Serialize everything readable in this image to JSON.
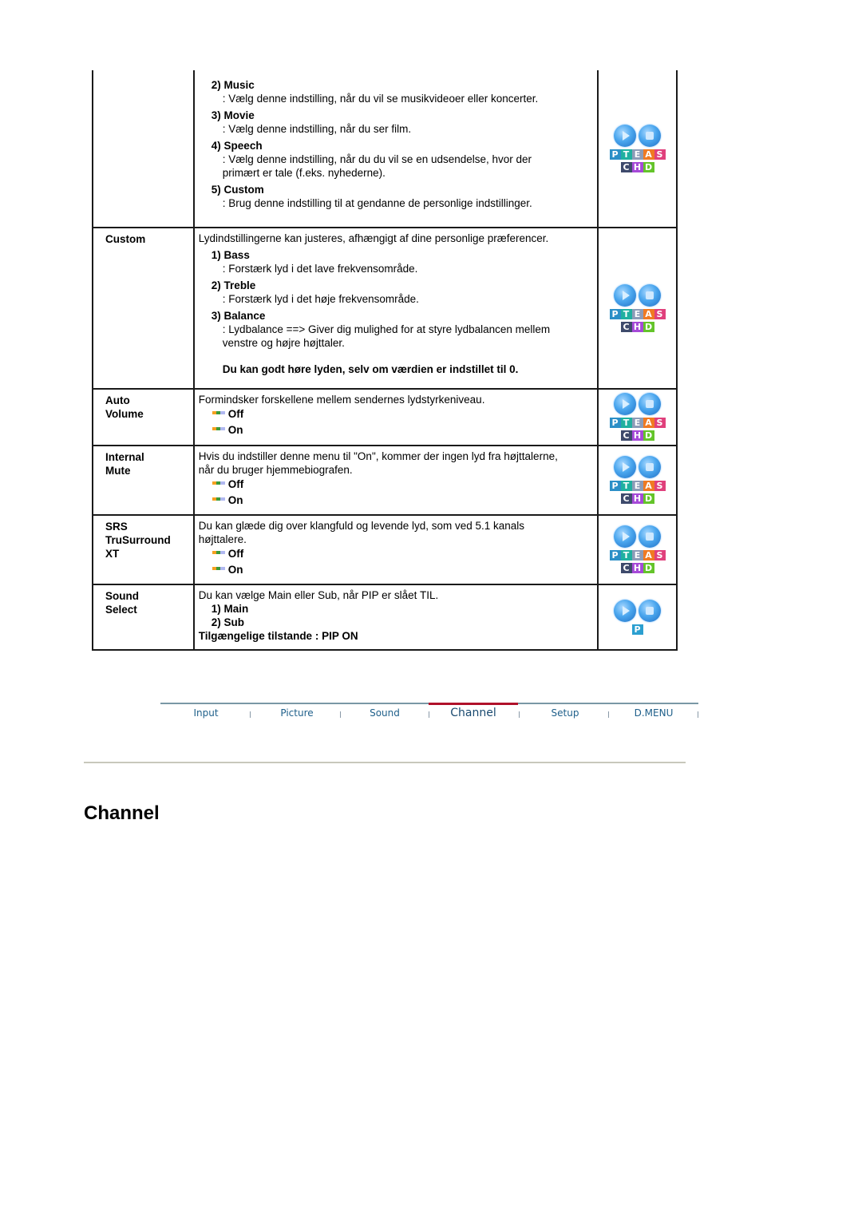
{
  "table": {
    "rows": [
      {
        "label_lines": [],
        "items": [
          {
            "title": "2) Music",
            "desc": [
              ": Vælg denne indstilling, når du vil se musikvideoer eller koncerter."
            ]
          },
          {
            "title": "3) Movie",
            "desc": [
              ": Vælg denne indstilling, når du ser film."
            ]
          },
          {
            "title": "4) Speech",
            "desc": [
              ": Vælg denne indstilling, når du du vil se en udsendelse, hvor der",
              "primært er tale (f.eks. nyhederne)."
            ]
          },
          {
            "title": "5) Custom",
            "desc": [
              ": Brug denne indstilling til at gendanne de personlige indstillinger."
            ]
          }
        ],
        "icon": "ptea-schd-mode-icon"
      },
      {
        "label_lines": [
          "Custom"
        ],
        "intro": "Lydindstillingerne kan justeres, afhængigt af dine personlige præferencer.",
        "items": [
          {
            "title": "1) Bass",
            "desc": [
              ": Forstærk lyd i det lave frekvensområde."
            ]
          },
          {
            "title": "2) Treble",
            "desc": [
              ": Forstærk lyd i det høje frekvensområde."
            ]
          },
          {
            "title": "3) Balance",
            "desc": [
              ": Lydbalance ==> Giver dig mulighed for at styre lydbalancen mellem",
              "venstre og højre højttaler."
            ]
          }
        ],
        "note": "Du kan godt høre lyden, selv om værdien er indstillet til 0.",
        "icon": "ptea-schd-mode-icon"
      },
      {
        "label_lines": [
          "Auto",
          "Volume"
        ],
        "intro": "Formindsker forskellene mellem sendernes lydstyrkeniveau.",
        "options": [
          "Off",
          "On"
        ],
        "icon": "ptea-schd-mode-icon"
      },
      {
        "label_lines": [
          "Internal",
          "Mute"
        ],
        "intro_lines": [
          "Hvis du indstiller denne menu til \"On\", kommer der ingen lyd fra højttalerne,",
          "når du bruger hjemmebiografen."
        ],
        "options": [
          "Off",
          "On"
        ],
        "icon": "ptea-schd-mode-icon"
      },
      {
        "label_lines": [
          "SRS",
          "TruSurround",
          "XT"
        ],
        "intro_lines": [
          "Du kan glæde dig over klangfuld og levende lyd, som ved 5.1 kanals",
          "højttalere."
        ],
        "options": [
          "Off",
          "On"
        ],
        "icon": "ptea-schd-mode-icon"
      },
      {
        "label_lines": [
          "Sound",
          "Select"
        ],
        "intro": "Du kan vælge Main eller Sub, når PIP er slået TIL.",
        "sub_items": [
          "1) Main",
          "2) Sub"
        ],
        "footer": "Tilgængelige tilstande : PIP ON",
        "icon": "p-mode-icon"
      }
    ]
  },
  "mode_icon": {
    "top_tiles": [
      {
        "letter": "P",
        "color": "#2b8fc7"
      },
      {
        "letter": "T",
        "color": "#1fb0a0"
      },
      {
        "letter": "E",
        "color": "#8c9cb8"
      },
      {
        "letter": "A",
        "color": "#f07a22"
      },
      {
        "letter": "S",
        "color": "#e0407c"
      }
    ],
    "bottom_tiles": [
      {
        "letter": "C",
        "color": "#3e4a6c"
      },
      {
        "letter": "H",
        "color": "#a64ad8"
      },
      {
        "letter": "D",
        "color": "#64c42a"
      }
    ],
    "p_tile": {
      "letter": "P",
      "color": "#2b9fd0"
    }
  },
  "bullet_colors": [
    "#f5a020",
    "#3a9a3a",
    "#b0b8f0"
  ],
  "nav": {
    "tabs": [
      "Input",
      "Picture",
      "Sound",
      "Channel",
      "Setup",
      "D.MENU"
    ],
    "active": "Channel"
  },
  "section": {
    "heading": "Channel"
  }
}
